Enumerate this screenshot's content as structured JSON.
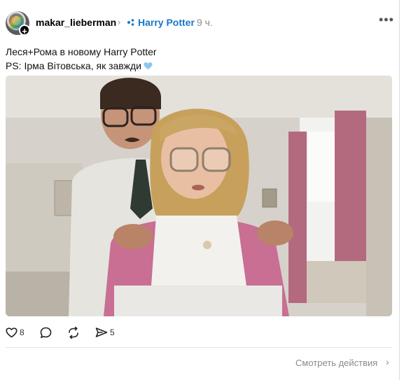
{
  "post": {
    "author": "makar_lieberman",
    "topic": "Harry Potter",
    "time": "9 ч.",
    "caption_line1": "Леся+Рома в новому Harry Potter",
    "caption_line2": "PS: Ірма Вітовська, як завжди"
  },
  "actions": {
    "likes": "8",
    "reposts": "5",
    "view_actions": "Смотреть действия"
  },
  "icons": {
    "avatar_badge": "plus-icon",
    "more": "more-horizontal-icon",
    "like": "heart-icon",
    "comment": "comment-bubble-icon",
    "repost": "repost-icon",
    "share": "send-icon",
    "emoji": "blue-heart-emoji"
  },
  "colors": {
    "topic": "#1877c9",
    "muted": "#8a8a8a",
    "emoji_heart": "#8ec7f0"
  }
}
